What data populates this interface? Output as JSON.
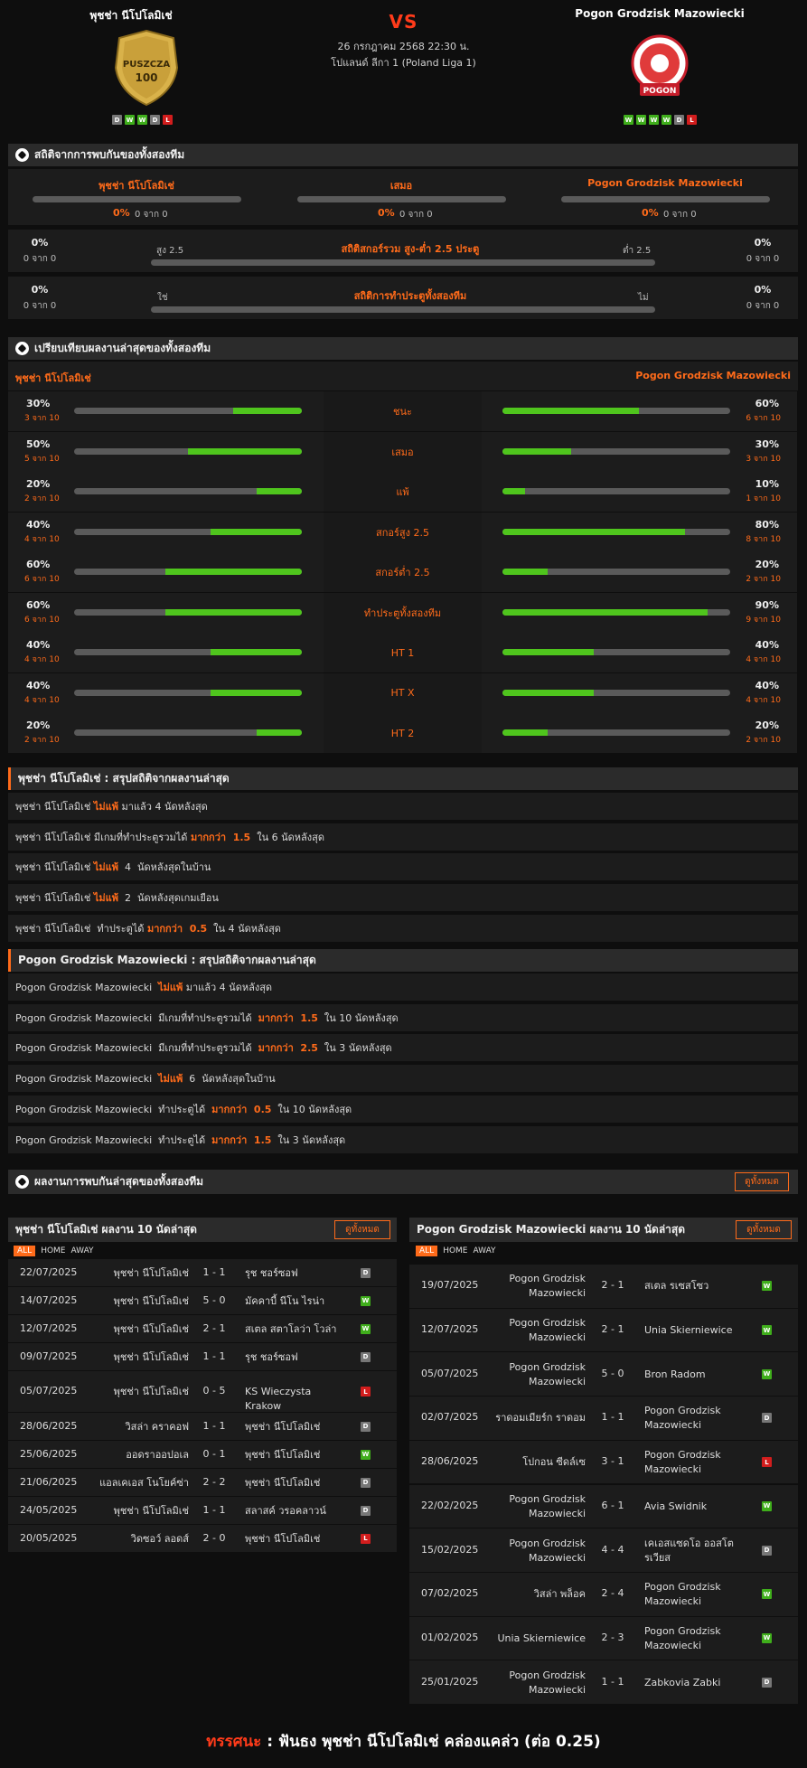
{
  "header": {
    "home_team": "พุชช่า นีโปโลมิเช่",
    "away_team": "Pogon Grodzisk Mazowiecki",
    "vs": "VS",
    "date": "26 กรกฎาคม 2568 22:30 น.",
    "league": "โปแลนด์ ลีกา 1 (Poland Liga 1)",
    "home_logo_text": "PUSZCZA",
    "home_logo_year": "100",
    "away_logo_text": "POGON",
    "home_form": [
      "D",
      "W",
      "W",
      "D",
      "L"
    ],
    "away_form": [
      "W",
      "W",
      "W",
      "W",
      "D",
      "L"
    ]
  },
  "h2h": {
    "title": "สถิติจากการพบกันของทั้งสองทีม",
    "cols": [
      {
        "name": "พุชช่า นีโปโลมิเช่",
        "pct": "0%",
        "of": "0 จาก 0"
      },
      {
        "name": "เสมอ",
        "pct": "0%",
        "of": "0 จาก 0"
      },
      {
        "name": "Pogon Grodzisk Mazowiecki",
        "pct": "0%",
        "of": "0 จาก 0"
      }
    ],
    "ou": {
      "title": "สถิติสกอร์รวม สูง-ต่ำ 2.5 ประตู",
      "left_label": "สูง 2.5",
      "right_label": "ต่ำ 2.5",
      "left_pct": "0%",
      "left_of": "0 จาก 0",
      "right_pct": "0%",
      "right_of": "0 จาก 0"
    },
    "btts": {
      "title": "สถิติการทำประตูทั้งสองทีม",
      "left_label": "ใช่",
      "right_label": "ไม่",
      "left_pct": "0%",
      "left_of": "0 จาก 0",
      "right_pct": "0%",
      "right_of": "0 จาก 0"
    }
  },
  "compare": {
    "title": "เปรียบเทียบผลงานล่าสุดของทั้งสองทีม",
    "home": "พุชช่า นีโปโลมิเช่",
    "away": "Pogon Grodzisk Mazowiecki",
    "rows": [
      {
        "label": "ชนะ",
        "hp": "30%",
        "hof": "3 จาก 10",
        "hv": 0.3,
        "ap": "60%",
        "aof": "6 จาก 10",
        "av": 0.6
      },
      {
        "label": "เสมอ",
        "hp": "50%",
        "hof": "5 จาก 10",
        "hv": 0.5,
        "ap": "30%",
        "aof": "3 จาก 10",
        "av": 0.3
      },
      {
        "label": "แพ้",
        "hp": "20%",
        "hof": "2 จาก 10",
        "hv": 0.2,
        "ap": "10%",
        "aof": "1 จาก 10",
        "av": 0.1
      },
      {
        "label": "สกอร์สูง 2.5",
        "hp": "40%",
        "hof": "4 จาก 10",
        "hv": 0.4,
        "ap": "80%",
        "aof": "8 จาก 10",
        "av": 0.8
      },
      {
        "label": "สกอร์ต่ำ 2.5",
        "hp": "60%",
        "hof": "6 จาก 10",
        "hv": 0.6,
        "ap": "20%",
        "aof": "2 จาก 10",
        "av": 0.2
      },
      {
        "label": "ทำประตูทั้งสองทีม",
        "hp": "60%",
        "hof": "6 จาก 10",
        "hv": 0.6,
        "ap": "90%",
        "aof": "9 จาก 10",
        "av": 0.9
      },
      {
        "label": "HT 1",
        "hp": "40%",
        "hof": "4 จาก 10",
        "hv": 0.4,
        "ap": "40%",
        "aof": "4 จาก 10",
        "av": 0.4
      },
      {
        "label": "HT X",
        "hp": "40%",
        "hof": "4 จาก 10",
        "hv": 0.4,
        "ap": "40%",
        "aof": "4 จาก 10",
        "av": 0.4
      },
      {
        "label": "HT 2",
        "hp": "20%",
        "hof": "2 จาก 10",
        "hv": 0.2,
        "ap": "20%",
        "aof": "2 จาก 10",
        "av": 0.2
      }
    ]
  },
  "home_summary": {
    "title": "พุชช่า นีโปโลมิเช่ : สรุปสถิติจากผลงานล่าสุด",
    "items": [
      {
        "a": "พุชช่า นีโปโลมิเช่ ",
        "b": "ไม่แพ้",
        "c": " มาแล้ว 4 นัดหลังสุด"
      },
      {
        "a": "พุชช่า นีโปโลมิเช่ มีเกมที่ทำประตูรวมได้ ",
        "b": "มากกว่า  1.5",
        "c": "  ใน 6 นัดหลังสุด"
      },
      {
        "a": "พุชช่า นีโปโลมิเช่ ",
        "b": "ไม่แพ้",
        "c": "  4  นัดหลังสุดในบ้าน"
      },
      {
        "a": "พุชช่า นีโปโลมิเช่ ",
        "b": "ไม่แพ้",
        "c": "  2  นัดหลังสุดเกมเยือน"
      },
      {
        "a": "พุชช่า นีโปโลมิเช่  ทำประตูได้ ",
        "b": "มากกว่า  0.5",
        "c": "  ใน 4 นัดหลังสุด"
      }
    ]
  },
  "away_summary": {
    "title": "Pogon Grodzisk Mazowiecki : สรุปสถิติจากผลงานล่าสุด",
    "items": [
      {
        "a": "Pogon Grodzisk Mazowiecki  ",
        "b": "ไม่แพ้",
        "c": " มาแล้ว 4 นัดหลังสุด"
      },
      {
        "a": "Pogon Grodzisk Mazowiecki  มีเกมที่ทำประตูรวมได้  ",
        "b": "มากกว่า  1.5",
        "c": "  ใน 10 นัดหลังสุด"
      },
      {
        "a": "Pogon Grodzisk Mazowiecki  มีเกมที่ทำประตูรวมได้  ",
        "b": "มากกว่า  2.5",
        "c": "  ใน 3 นัดหลังสุด"
      },
      {
        "a": "Pogon Grodzisk Mazowiecki  ",
        "b": "ไม่แพ้",
        "c": "  6  นัดหลังสุดในบ้าน"
      },
      {
        "a": "Pogon Grodzisk Mazowiecki  ทำประตูได้  ",
        "b": "มากกว่า  0.5",
        "c": "  ใน 10 นัดหลังสุด"
      },
      {
        "a": "Pogon Grodzisk Mazowiecki  ทำประตูได้  ",
        "b": "มากกว่า  1.5",
        "c": "  ใน 3 นัดหลังสุด"
      }
    ]
  },
  "recent": {
    "title": "ผลงานการพบกันล่าสุดของทั้งสองทีม",
    "view_all": "ดูทั้งหมด",
    "tabs": {
      "all": "ALL",
      "home": "HOME",
      "away": "AWAY"
    },
    "home": {
      "title": "พุชช่า นีโปโลมิเช่ ผลงาน 10 นัดล่าสุด",
      "matches": [
        {
          "date": "22/07/2025",
          "home": "พุชช่า นีโปโลมิเช่",
          "score": "1 - 1",
          "away": "รุช ชอร์ซอฟ",
          "r": "D"
        },
        {
          "date": "14/07/2025",
          "home": "พุชช่า นีโปโลมิเช่",
          "score": "5 - 0",
          "away": "มัคคาบี้ นีโน ไรน่า",
          "r": "W"
        },
        {
          "date": "12/07/2025",
          "home": "พุชช่า นีโปโลมิเช่",
          "score": "2 - 1",
          "away": "สเตล สตาโลว่า โวล่า",
          "r": "W"
        },
        {
          "date": "09/07/2025",
          "home": "พุชช่า นีโปโลมิเช่",
          "score": "1 - 1",
          "away": "รุช ชอร์ซอฟ",
          "r": "D"
        },
        {
          "date": "05/07/2025",
          "home": "พุชช่า นีโปโลมิเช่",
          "score": "0 - 5",
          "away": "KS Wieczysta Krakow",
          "r": "L"
        },
        {
          "date": "28/06/2025",
          "home": "วิสล่า คราคอฟ",
          "score": "1 - 1",
          "away": "พุชช่า นีโปโลมิเช่",
          "r": "D"
        },
        {
          "date": "25/06/2025",
          "home": "ออดราออปอเล",
          "score": "0 - 1",
          "away": "พุชช่า นีโปโลมิเช่",
          "r": "W"
        },
        {
          "date": "21/06/2025",
          "home": "แอลเคเอส โนโยค์ซ่า",
          "score": "2 - 2",
          "away": "พุชช่า นีโปโลมิเช่",
          "r": "D"
        },
        {
          "date": "24/05/2025",
          "home": "พุชช่า นีโปโลมิเช่",
          "score": "1 - 1",
          "away": "สลาสค์ วรอคลาวน์",
          "r": "D"
        },
        {
          "date": "20/05/2025",
          "home": "วิดซอว์ ลอดส์",
          "score": "2 - 0",
          "away": "พุชช่า นีโปโลมิเช่",
          "r": "L"
        }
      ]
    },
    "away": {
      "title": "Pogon Grodzisk Mazowiecki ผลงาน 10 นัดล่าสุด",
      "matches": [
        {
          "date": "19/07/2025",
          "home": "Pogon Grodzisk Mazowiecki",
          "score": "2 - 1",
          "away": "สเตล รเซสโซว",
          "r": "W"
        },
        {
          "date": "12/07/2025",
          "home": "Pogon Grodzisk Mazowiecki",
          "score": "2 - 1",
          "away": "Unia Skierniewice",
          "r": "W"
        },
        {
          "date": "05/07/2025",
          "home": "Pogon Grodzisk Mazowiecki",
          "score": "5 - 0",
          "away": "Bron Radom",
          "r": "W"
        },
        {
          "date": "02/07/2025",
          "home": "ราดอมเมียร์ก ราดอม",
          "score": "1 - 1",
          "away": "Pogon Grodzisk Mazowiecki",
          "r": "D"
        },
        {
          "date": "28/06/2025",
          "home": "โปกอน ซีดล์เซ",
          "score": "3 - 1",
          "away": "Pogon Grodzisk Mazowiecki",
          "r": "L"
        },
        {
          "date": "22/02/2025",
          "home": "Pogon Grodzisk Mazowiecki",
          "score": "6 - 1",
          "away": "Avia Swidnik",
          "r": "W"
        },
        {
          "date": "15/02/2025",
          "home": "Pogon Grodzisk Mazowiecki",
          "score": "4 - 4",
          "away": "เคเอสแซดโอ ออสโตรเวียส",
          "r": "D"
        },
        {
          "date": "07/02/2025",
          "home": "วิสล่า พล็อค",
          "score": "2 - 4",
          "away": "Pogon Grodzisk Mazowiecki",
          "r": "W"
        },
        {
          "date": "01/02/2025",
          "home": "Unia Skierniewice",
          "score": "2 - 3",
          "away": "Pogon Grodzisk Mazowiecki",
          "r": "W"
        },
        {
          "date": "25/01/2025",
          "home": "Pogon Grodzisk Mazowiecki",
          "score": "1 - 1",
          "away": "Zabkovia Zabki",
          "r": "D"
        }
      ]
    }
  },
  "verdict": {
    "label": "ทรรศนะ",
    "sep": " : ",
    "text": "ฟันธง พุชช่า นีโปโลมิเช่ คล่องแคล่ว (ต่อ 0.25)"
  },
  "colors": {
    "accent": "#ff6b1a",
    "win": "#3fae1b",
    "draw": "#777777",
    "loss": "#d21d1d",
    "bar_fill": "#4fc51d"
  }
}
